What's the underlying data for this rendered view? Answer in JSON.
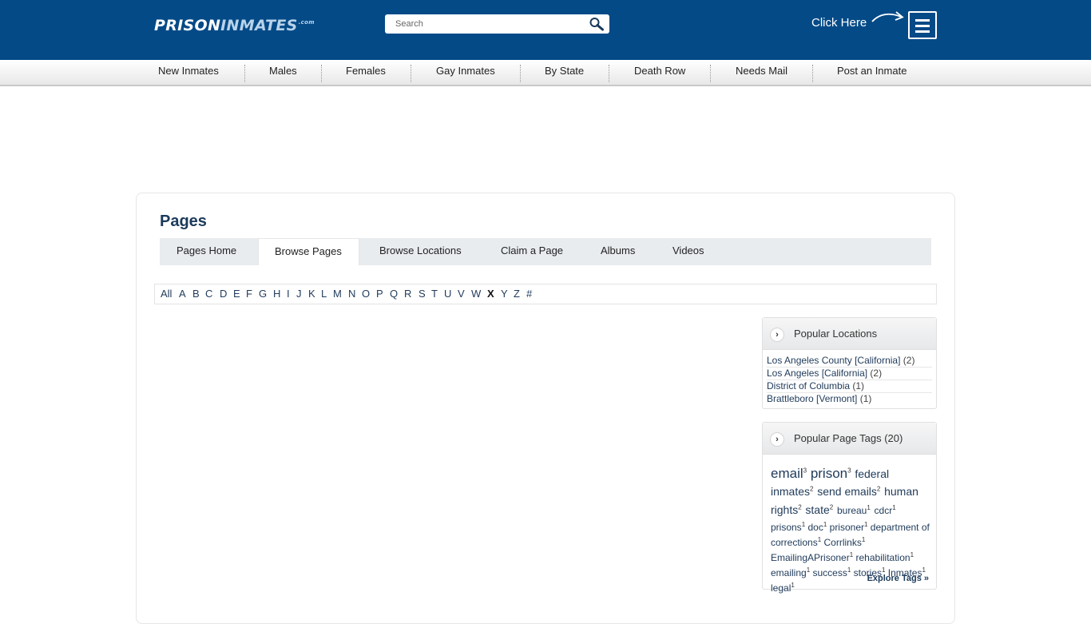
{
  "header": {
    "logo_part1": "PRISON",
    "logo_part2": "INMATES",
    "logo_part3": ".com",
    "search_placeholder": "Search",
    "click_here": "Click Here"
  },
  "nav": [
    "New Inmates",
    "Males",
    "Females",
    "Gay Inmates",
    "By State",
    "Death Row",
    "Needs Mail",
    "Post an Inmate"
  ],
  "main": {
    "title": "Pages",
    "tabs": [
      "Pages Home",
      "Browse Pages",
      "Browse Locations",
      "Claim a Page",
      "Albums",
      "Videos"
    ],
    "active_tab": "Browse Pages",
    "alphabet": [
      "All",
      "A",
      "B",
      "C",
      "D",
      "E",
      "F",
      "G",
      "H",
      "I",
      "J",
      "K",
      "L",
      "M",
      "N",
      "O",
      "P",
      "Q",
      "R",
      "S",
      "T",
      "U",
      "V",
      "W",
      "X",
      "Y",
      "Z",
      "#"
    ],
    "active_letter": "X"
  },
  "popular_locations": {
    "title": "Popular Locations",
    "items": [
      {
        "name": "Los Angeles County [California]",
        "count": "(2)"
      },
      {
        "name": "Los Angeles [California]",
        "count": "(2)"
      },
      {
        "name": "District of Columbia",
        "count": "(1)"
      },
      {
        "name": "Brattleboro [Vermont]",
        "count": "(1)"
      }
    ]
  },
  "popular_tags": {
    "title": "Popular Page Tags (20)",
    "tags": [
      {
        "name": "email",
        "count": "3"
      },
      {
        "name": "prison",
        "count": "3"
      },
      {
        "name": "federal inmates",
        "count": "2"
      },
      {
        "name": "send emails",
        "count": "2"
      },
      {
        "name": "human rights",
        "count": "2"
      },
      {
        "name": "state",
        "count": "2"
      },
      {
        "name": "bureau",
        "count": "1"
      },
      {
        "name": "cdcr",
        "count": "1"
      },
      {
        "name": "prisons",
        "count": "1"
      },
      {
        "name": "doc",
        "count": "1"
      },
      {
        "name": "prisoner",
        "count": "1"
      },
      {
        "name": "department of corrections",
        "count": "1"
      },
      {
        "name": "Corrlinks",
        "count": "1"
      },
      {
        "name": "EmailingAPrisoner",
        "count": "1"
      },
      {
        "name": "rehabilitation",
        "count": "1"
      },
      {
        "name": "emailing",
        "count": "1"
      },
      {
        "name": "success",
        "count": "1"
      },
      {
        "name": "stories",
        "count": "1"
      },
      {
        "name": "Inmates",
        "count": "1"
      },
      {
        "name": "legal",
        "count": "1"
      }
    ],
    "explore": "Explore Tags »"
  },
  "colors": {
    "header_bg": "#044a87",
    "link": "#1f3a5a"
  },
  "icons": {
    "search": "magnifier-icon",
    "menu": "hamburger-icon",
    "arrow": "curved-arrow-icon",
    "box_head": "chevron-right-icon"
  }
}
